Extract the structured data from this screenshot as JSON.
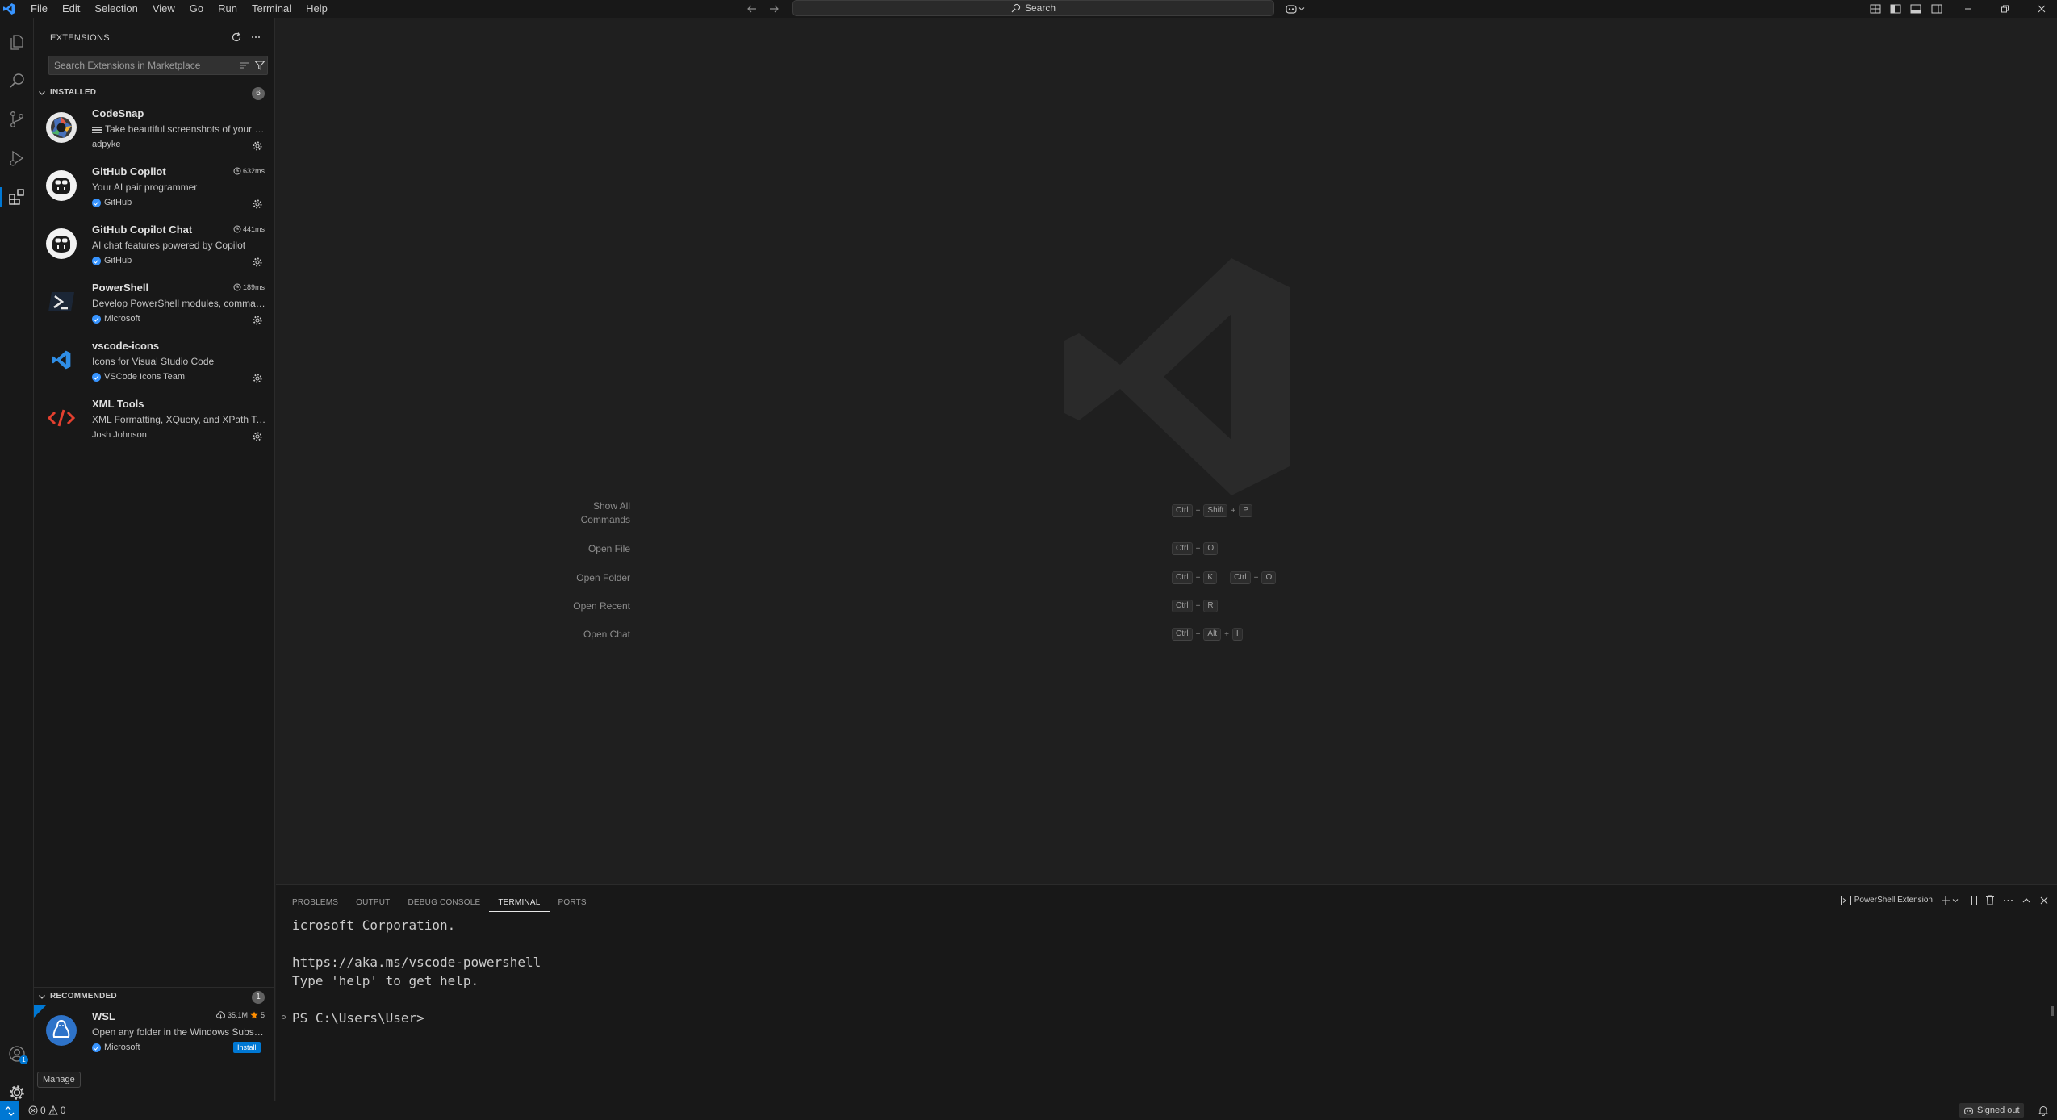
{
  "menu": [
    "File",
    "Edit",
    "Selection",
    "View",
    "Go",
    "Run",
    "Terminal",
    "Help"
  ],
  "search": {
    "label": "Search"
  },
  "sidebar": {
    "title": "EXTENSIONS",
    "search_placeholder": "Search Extensions in Marketplace",
    "installed": {
      "label": "INSTALLED",
      "count": "6",
      "items": [
        {
          "name": "CodeSnap",
          "description": "Take beautiful screenshots of your code",
          "publisher": "adpyke",
          "verified": false,
          "time": ""
        },
        {
          "name": "GitHub Copilot",
          "description": "Your AI pair programmer",
          "publisher": "GitHub",
          "verified": true,
          "time": "632ms"
        },
        {
          "name": "GitHub Copilot Chat",
          "description": "AI chat features powered by Copilot",
          "publisher": "GitHub",
          "verified": true,
          "time": "441ms"
        },
        {
          "name": "PowerShell",
          "description": "Develop PowerShell modules, commands and scripts",
          "publisher": "Microsoft",
          "verified": true,
          "time": "189ms"
        },
        {
          "name": "vscode-icons",
          "description": "Icons for Visual Studio Code",
          "publisher": "VSCode Icons Team",
          "verified": true,
          "time": ""
        },
        {
          "name": "XML Tools",
          "description": "XML Formatting, XQuery, and XPath Tools",
          "publisher": "Josh Johnson",
          "verified": false,
          "time": ""
        }
      ]
    },
    "recommended": {
      "label": "RECOMMENDED",
      "count": "1",
      "items": [
        {
          "name": "WSL",
          "description": "Open any folder in the Windows Subsystem for Linux",
          "publisher": "Microsoft",
          "downloads": "35.1M",
          "rating": "5",
          "install_label": "Install"
        }
      ]
    },
    "manage_tooltip": "Manage"
  },
  "editor": {
    "shortcuts": [
      {
        "label": "Show All Commands",
        "keys": [
          [
            "Ctrl",
            "Shift",
            "P"
          ]
        ]
      },
      {
        "label": "Open File",
        "keys": [
          [
            "Ctrl",
            "O"
          ]
        ]
      },
      {
        "label": "Open Folder",
        "keys": [
          [
            "Ctrl",
            "K"
          ],
          [
            "Ctrl",
            "O"
          ]
        ]
      },
      {
        "label": "Open Recent",
        "keys": [
          [
            "Ctrl",
            "R"
          ]
        ]
      },
      {
        "label": "Open Chat",
        "keys": [
          [
            "Ctrl",
            "Alt",
            "I"
          ]
        ]
      }
    ]
  },
  "panel": {
    "tabs": [
      "PROBLEMS",
      "OUTPUT",
      "DEBUG CONSOLE",
      "TERMINAL",
      "PORTS"
    ],
    "active_tab": "TERMINAL",
    "terminal_name": "PowerShell Extension",
    "lines": [
      "icrosoft Corporation.",
      "",
      "https://aka.ms/vscode-powershell",
      "Type 'help' to get help.",
      "",
      "PS C:\\Users\\User>"
    ]
  },
  "status": {
    "errors": "0",
    "warnings": "0",
    "signed_out": "Signed out"
  },
  "colors": {
    "accent": "#0078d4",
    "background": "#1f1f1f",
    "sidebar": "#181818"
  }
}
